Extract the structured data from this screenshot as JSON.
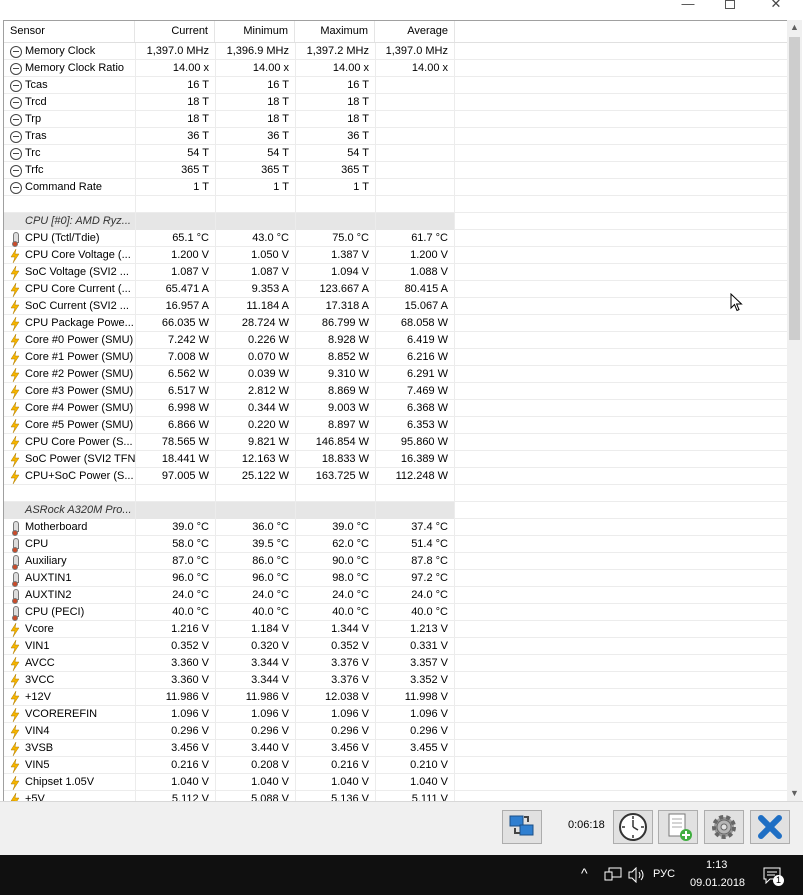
{
  "window": {
    "minimize_glyph": "—",
    "close_glyph": "✕"
  },
  "columns": {
    "sensor": "Sensor",
    "current": "Current",
    "minimum": "Minimum",
    "maximum": "Maximum",
    "average": "Average"
  },
  "rows": [
    {
      "icon": "clock-icon",
      "sensor": "Memory Clock",
      "current": "1,397.0 MHz",
      "minimum": "1,396.9 MHz",
      "maximum": "1,397.2 MHz",
      "average": "1,397.0 MHz"
    },
    {
      "icon": "clock-icon",
      "sensor": "Memory Clock Ratio",
      "current": "14.00 x",
      "minimum": "14.00 x",
      "maximum": "14.00 x",
      "average": "14.00 x"
    },
    {
      "icon": "clock-icon",
      "sensor": "Tcas",
      "current": "16 T",
      "minimum": "16 T",
      "maximum": "16 T",
      "average": ""
    },
    {
      "icon": "clock-icon",
      "sensor": "Trcd",
      "current": "18 T",
      "minimum": "18 T",
      "maximum": "18 T",
      "average": ""
    },
    {
      "icon": "clock-icon",
      "sensor": "Trp",
      "current": "18 T",
      "minimum": "18 T",
      "maximum": "18 T",
      "average": ""
    },
    {
      "icon": "clock-icon",
      "sensor": "Tras",
      "current": "36 T",
      "minimum": "36 T",
      "maximum": "36 T",
      "average": ""
    },
    {
      "icon": "clock-icon",
      "sensor": "Trc",
      "current": "54 T",
      "minimum": "54 T",
      "maximum": "54 T",
      "average": ""
    },
    {
      "icon": "clock-icon",
      "sensor": "Trfc",
      "current": "365 T",
      "minimum": "365 T",
      "maximum": "365 T",
      "average": ""
    },
    {
      "icon": "clock-icon",
      "sensor": "Command Rate",
      "current": "1 T",
      "minimum": "1 T",
      "maximum": "1 T",
      "average": ""
    },
    {
      "spacer": true
    },
    {
      "group": true,
      "icon": "chip-icon",
      "sensor": "CPU [#0]: AMD Ryz..."
    },
    {
      "icon": "thermometer-icon",
      "sensor": "CPU (Tctl/Tdie)",
      "current": "65.1 °C",
      "minimum": "43.0 °C",
      "maximum": "75.0 °C",
      "average": "61.7 °C"
    },
    {
      "icon": "bolt-icon",
      "sensor": "CPU Core Voltage (...",
      "current": "1.200 V",
      "minimum": "1.050 V",
      "maximum": "1.387 V",
      "average": "1.200 V"
    },
    {
      "icon": "bolt-icon",
      "sensor": "SoC Voltage (SVI2 ...",
      "current": "1.087 V",
      "minimum": "1.087 V",
      "maximum": "1.094 V",
      "average": "1.088 V"
    },
    {
      "icon": "bolt-icon",
      "sensor": "CPU Core Current (...",
      "current": "65.471 A",
      "minimum": "9.353 A",
      "maximum": "123.667 A",
      "average": "80.415 A"
    },
    {
      "icon": "bolt-icon",
      "sensor": "SoC Current (SVI2 ...",
      "current": "16.957 A",
      "minimum": "11.184 A",
      "maximum": "17.318 A",
      "average": "15.067 A"
    },
    {
      "icon": "bolt-icon",
      "sensor": "CPU Package Powe...",
      "current": "66.035 W",
      "minimum": "28.724 W",
      "maximum": "86.799 W",
      "average": "68.058 W"
    },
    {
      "icon": "bolt-icon",
      "sensor": "Core #0 Power (SMU)",
      "current": "7.242 W",
      "minimum": "0.226 W",
      "maximum": "8.928 W",
      "average": "6.419 W"
    },
    {
      "icon": "bolt-icon",
      "sensor": "Core #1 Power (SMU)",
      "current": "7.008 W",
      "minimum": "0.070 W",
      "maximum": "8.852 W",
      "average": "6.216 W"
    },
    {
      "icon": "bolt-icon",
      "sensor": "Core #2 Power (SMU)",
      "current": "6.562 W",
      "minimum": "0.039 W",
      "maximum": "9.310 W",
      "average": "6.291 W"
    },
    {
      "icon": "bolt-icon",
      "sensor": "Core #3 Power (SMU)",
      "current": "6.517 W",
      "minimum": "2.812 W",
      "maximum": "8.869 W",
      "average": "7.469 W"
    },
    {
      "icon": "bolt-icon",
      "sensor": "Core #4 Power (SMU)",
      "current": "6.998 W",
      "minimum": "0.344 W",
      "maximum": "9.003 W",
      "average": "6.368 W"
    },
    {
      "icon": "bolt-icon",
      "sensor": "Core #5 Power (SMU)",
      "current": "6.866 W",
      "minimum": "0.220 W",
      "maximum": "8.897 W",
      "average": "6.353 W"
    },
    {
      "icon": "bolt-icon",
      "sensor": "CPU Core Power (S...",
      "current": "78.565 W",
      "minimum": "9.821 W",
      "maximum": "146.854 W",
      "average": "95.860 W"
    },
    {
      "icon": "bolt-icon",
      "sensor": "SoC Power (SVI2 TFN)",
      "current": "18.441 W",
      "minimum": "12.163 W",
      "maximum": "18.833 W",
      "average": "16.389 W"
    },
    {
      "icon": "bolt-icon",
      "sensor": "CPU+SoC Power (S...",
      "current": "97.005 W",
      "minimum": "25.122 W",
      "maximum": "163.725 W",
      "average": "112.248 W"
    },
    {
      "spacer": true
    },
    {
      "group": true,
      "icon": "chip-icon",
      "sensor": "ASRock A320M Pro..."
    },
    {
      "icon": "thermometer-icon",
      "sensor": "Motherboard",
      "current": "39.0 °C",
      "minimum": "36.0 °C",
      "maximum": "39.0 °C",
      "average": "37.4 °C"
    },
    {
      "icon": "thermometer-icon",
      "sensor": "CPU",
      "current": "58.0 °C",
      "minimum": "39.5 °C",
      "maximum": "62.0 °C",
      "average": "51.4 °C"
    },
    {
      "icon": "thermometer-icon",
      "sensor": "Auxiliary",
      "current": "87.0 °C",
      "minimum": "86.0 °C",
      "maximum": "90.0 °C",
      "average": "87.8 °C"
    },
    {
      "icon": "thermometer-icon",
      "sensor": "AUXTIN1",
      "current": "96.0 °C",
      "minimum": "96.0 °C",
      "maximum": "98.0 °C",
      "average": "97.2 °C"
    },
    {
      "icon": "thermometer-icon",
      "sensor": "AUXTIN2",
      "current": "24.0 °C",
      "minimum": "24.0 °C",
      "maximum": "24.0 °C",
      "average": "24.0 °C"
    },
    {
      "icon": "thermometer-icon",
      "sensor": "CPU (PECI)",
      "current": "40.0 °C",
      "minimum": "40.0 °C",
      "maximum": "40.0 °C",
      "average": "40.0 °C"
    },
    {
      "icon": "bolt-icon",
      "sensor": "Vcore",
      "current": "1.216 V",
      "minimum": "1.184 V",
      "maximum": "1.344 V",
      "average": "1.213 V"
    },
    {
      "icon": "bolt-icon",
      "sensor": "VIN1",
      "current": "0.352 V",
      "minimum": "0.320 V",
      "maximum": "0.352 V",
      "average": "0.331 V"
    },
    {
      "icon": "bolt-icon",
      "sensor": "AVCC",
      "current": "3.360 V",
      "minimum": "3.344 V",
      "maximum": "3.376 V",
      "average": "3.357 V"
    },
    {
      "icon": "bolt-icon",
      "sensor": "3VCC",
      "current": "3.360 V",
      "minimum": "3.344 V",
      "maximum": "3.376 V",
      "average": "3.352 V"
    },
    {
      "icon": "bolt-icon",
      "sensor": "+12V",
      "current": "11.986 V",
      "minimum": "11.986 V",
      "maximum": "12.038 V",
      "average": "11.998 V"
    },
    {
      "icon": "bolt-icon",
      "sensor": "VCOREREFIN",
      "current": "1.096 V",
      "minimum": "1.096 V",
      "maximum": "1.096 V",
      "average": "1.096 V"
    },
    {
      "icon": "bolt-icon",
      "sensor": "VIN4",
      "current": "0.296 V",
      "minimum": "0.296 V",
      "maximum": "0.296 V",
      "average": "0.296 V"
    },
    {
      "icon": "bolt-icon",
      "sensor": "3VSB",
      "current": "3.456 V",
      "minimum": "3.440 V",
      "maximum": "3.456 V",
      "average": "3.455 V"
    },
    {
      "icon": "bolt-icon",
      "sensor": "VIN5",
      "current": "0.216 V",
      "minimum": "0.208 V",
      "maximum": "0.216 V",
      "average": "0.210 V"
    },
    {
      "icon": "bolt-icon",
      "sensor": "Chipset 1.05V",
      "current": "1.040 V",
      "minimum": "1.040 V",
      "maximum": "1.040 V",
      "average": "1.040 V"
    },
    {
      "icon": "bolt-icon",
      "sensor": "+5V",
      "current": "5.112 V",
      "minimum": "5.088 V",
      "maximum": "5.136 V",
      "average": "5.111 V"
    }
  ],
  "toolbar": {
    "elapsed_time": "0:06:18",
    "buttons": [
      "network-sensors-icon",
      "clock-timer-icon",
      "add-report-icon",
      "settings-gear-icon",
      "close-x-icon"
    ]
  },
  "taskbar": {
    "tray_chevron": "^",
    "language": "РУС",
    "time": "1:13",
    "date": "09.01.2018",
    "notification_count": "1"
  },
  "colors": {
    "bolt": "#f5b400",
    "group_bg": "#e6e6e6",
    "close_x": "#1f6fc4",
    "taskbar_bg": "#101010"
  }
}
